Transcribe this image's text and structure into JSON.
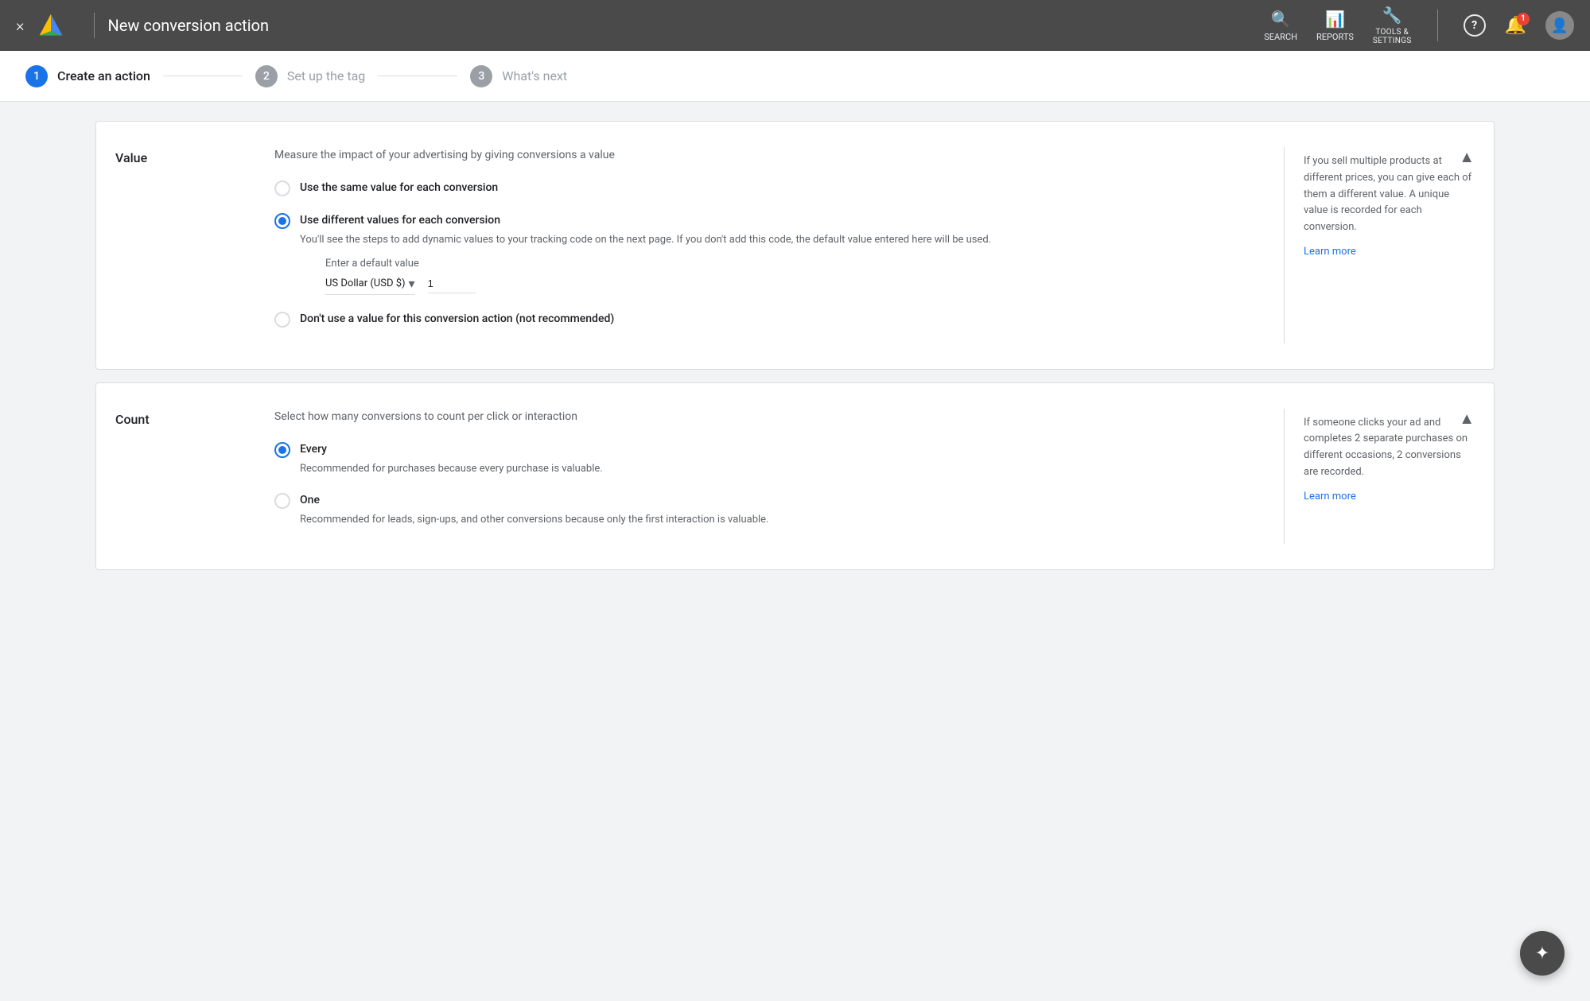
{
  "header": {
    "title": "New conversion action",
    "close_icon": "×",
    "nav_items": [
      {
        "id": "search",
        "label": "SEARCH",
        "icon": "🔍"
      },
      {
        "id": "reports",
        "label": "REPORTS",
        "icon": "📊"
      },
      {
        "id": "tools",
        "label": "TOOLS &\nSETTINGS",
        "icon": "🔧"
      }
    ],
    "help_icon": "?",
    "notification_count": "1",
    "avatar_icon": "👤"
  },
  "stepper": {
    "steps": [
      {
        "number": "1",
        "label": "Create an action",
        "state": "active"
      },
      {
        "number": "2",
        "label": "Set up the tag",
        "state": "inactive"
      },
      {
        "number": "3",
        "label": "What's next",
        "state": "inactive"
      }
    ]
  },
  "value_section": {
    "label": "Value",
    "description": "Measure the impact of your advertising by giving conversions a value",
    "options": [
      {
        "id": "same-value",
        "label": "Use the same value for each conversion",
        "sublabel": "",
        "selected": false
      },
      {
        "id": "different-values",
        "label": "Use different values for each conversion",
        "sublabel": "You'll see the steps to add dynamic values to your tracking code on the next page. If you don't add this code, the default value entered here will be used.",
        "selected": true
      },
      {
        "id": "no-value",
        "label": "Don't use a value for this conversion action (not recommended)",
        "sublabel": "",
        "selected": false
      }
    ],
    "default_value_label": "Enter a default value",
    "currency_label": "US Dollar (USD $)",
    "currency_chevron": "▾",
    "value_input": "1",
    "help_text": "If you sell multiple products at different prices, you can give each of them a different value. A unique value is recorded for each conversion.",
    "learn_more_label": "Learn more",
    "collapse_icon": "▲"
  },
  "count_section": {
    "label": "Count",
    "description": "Select how many conversions to count per click or interaction",
    "options": [
      {
        "id": "every",
        "label": "Every",
        "sublabel": "Recommended for purchases because every purchase is valuable.",
        "selected": true
      },
      {
        "id": "one",
        "label": "One",
        "sublabel": "Recommended for leads, sign-ups, and other conversions because only the first interaction is valuable.",
        "selected": false
      }
    ],
    "help_text": "If someone clicks your ad and completes 2 separate purchases on different occasions, 2 conversions are recorded.",
    "learn_more_label": "Learn more",
    "collapse_icon": "▲"
  },
  "fab": {
    "icon": "★"
  }
}
